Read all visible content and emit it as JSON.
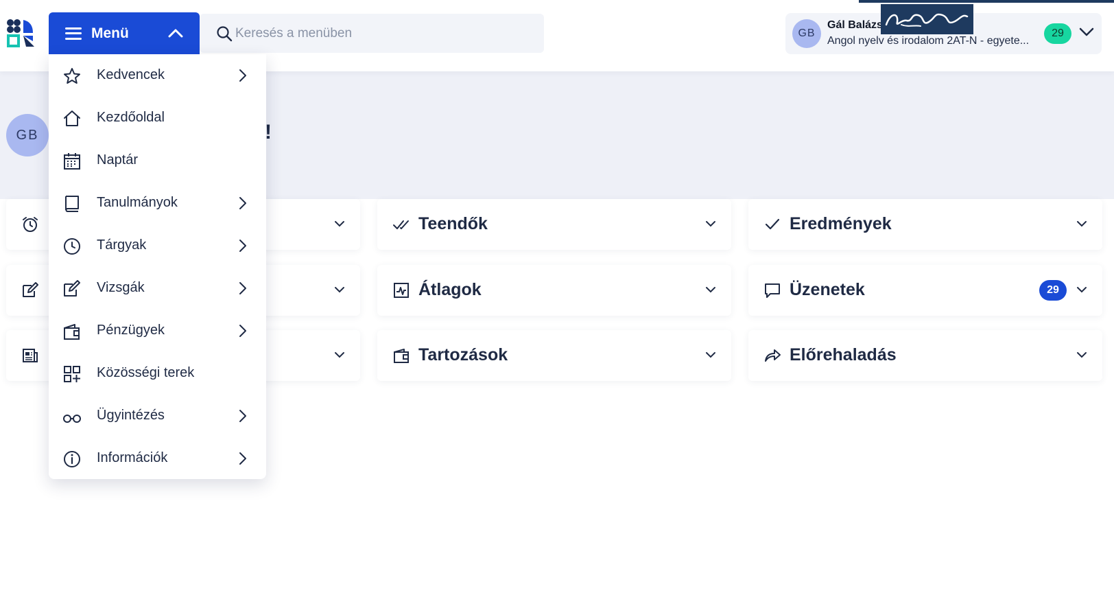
{
  "header": {
    "menu_label": "Menü",
    "search_placeholder": "Keresés a menüben",
    "profile": {
      "initials": "GB",
      "name": "Gál Balázs",
      "program": "Angol nyelv és irodalom 2AT-N - egyete...",
      "badge": "29"
    }
  },
  "hero": {
    "initials": "GB",
    "greeting_suffix": "!"
  },
  "menu": {
    "items": [
      {
        "label": "Kedvencek",
        "icon": "star-icon",
        "has_submenu": true
      },
      {
        "label": "Kezdőoldal",
        "icon": "home-icon",
        "has_submenu": false
      },
      {
        "label": "Naptár",
        "icon": "calendar-icon",
        "has_submenu": false
      },
      {
        "label": "Tanulmányok",
        "icon": "book-icon",
        "has_submenu": true
      },
      {
        "label": "Tárgyak",
        "icon": "clock-icon",
        "has_submenu": true
      },
      {
        "label": "Vizsgák",
        "icon": "edit-icon",
        "has_submenu": true
      },
      {
        "label": "Pénzügyek",
        "icon": "wallet-icon",
        "has_submenu": true
      },
      {
        "label": "Közösségi terek",
        "icon": "grid-add-icon",
        "has_submenu": false
      },
      {
        "label": "Ügyintézés",
        "icon": "glasses-icon",
        "has_submenu": true
      },
      {
        "label": "Információk",
        "icon": "info-icon",
        "has_submenu": true
      }
    ]
  },
  "cards": {
    "col1": [
      {
        "icon": "alarm-icon"
      },
      {
        "icon": "edit-icon"
      },
      {
        "icon": "newspaper-icon"
      }
    ],
    "teendok": {
      "title": "Teendők",
      "icon": "double-check-icon"
    },
    "eredmenyek": {
      "title": "Eredmények",
      "icon": "check-icon"
    },
    "atlagok": {
      "title": "Átlagok",
      "icon": "chart-icon"
    },
    "uzenetek": {
      "title": "Üzenetek",
      "icon": "message-icon",
      "badge": "29"
    },
    "tartozasok": {
      "title": "Tartozások",
      "icon": "wallet-icon"
    },
    "eloreh": {
      "title": "Előrehaladás",
      "icon": "forward-icon"
    }
  },
  "colors": {
    "primary": "#1a4bd6",
    "success_badge": "#17d6a0",
    "hero_bg": "#eef0f7",
    "avatar": "#a9b8f0"
  }
}
